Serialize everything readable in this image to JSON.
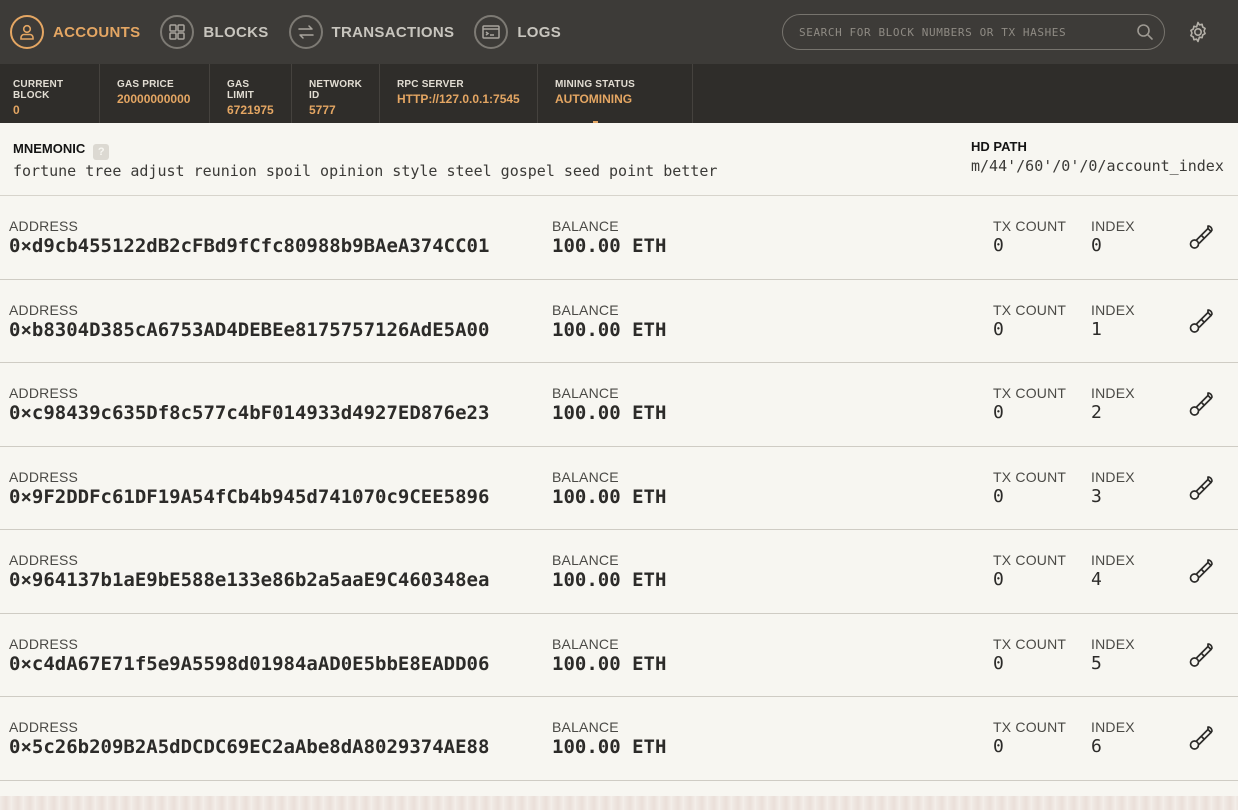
{
  "nav": {
    "items": [
      {
        "label": "ACCOUNTS",
        "icon": "person-icon",
        "active": true
      },
      {
        "label": "BLOCKS",
        "icon": "blocks-icon",
        "active": false
      },
      {
        "label": "TRANSACTIONS",
        "icon": "transfer-icon",
        "active": false
      },
      {
        "label": "LOGS",
        "icon": "terminal-icon",
        "active": false
      }
    ],
    "search_placeholder": "SEARCH FOR BLOCK NUMBERS OR TX HASHES"
  },
  "stats": {
    "current_block_label": "CURRENT BLOCK",
    "current_block": "0",
    "gas_price_label": "GAS PRICE",
    "gas_price": "20000000000",
    "gas_limit_label": "GAS LIMIT",
    "gas_limit": "6721975",
    "network_id_label": "NETWORK ID",
    "network_id": "5777",
    "rpc_server_label": "RPC SERVER",
    "rpc_server": "HTTP://127.0.0.1:7545",
    "mining_status_label": "MINING STATUS",
    "mining_status": "AUTOMINING"
  },
  "mnemonic": {
    "label": "MNEMONIC",
    "help": "?",
    "words": "fortune tree adjust reunion spoil opinion style steel gospel seed point better",
    "hd_path_label": "HD PATH",
    "hd_path": "m/44'/60'/0'/0/account_index"
  },
  "row_labels": {
    "address": "ADDRESS",
    "balance": "BALANCE",
    "tx_count": "TX COUNT",
    "index": "INDEX"
  },
  "accounts": [
    {
      "address": "0×d9cb455122dB2cFBd9fCfc80988b9BAeA374CC01",
      "balance": "100.00 ETH",
      "tx_count": "0",
      "index": "0"
    },
    {
      "address": "0×b8304D385cA6753AD4DEBEe8175757126AdE5A00",
      "balance": "100.00 ETH",
      "tx_count": "0",
      "index": "1"
    },
    {
      "address": "0×c98439c635Df8c577c4bF014933d4927ED876e23",
      "balance": "100.00 ETH",
      "tx_count": "0",
      "index": "2"
    },
    {
      "address": "0×9F2DDFc61DF19A54fCb4b945d741070c9CEE5896",
      "balance": "100.00 ETH",
      "tx_count": "0",
      "index": "3"
    },
    {
      "address": "0×964137b1aE9bE588e133e86b2a5aaE9C460348ea",
      "balance": "100.00 ETH",
      "tx_count": "0",
      "index": "4"
    },
    {
      "address": "0×c4dA67E71f5e9A5598d01984aAD0E5bbE8EADD06",
      "balance": "100.00 ETH",
      "tx_count": "0",
      "index": "5"
    },
    {
      "address": "0×5c26b209B2A5dDCDC69EC2aAbe8dA8029374AE88",
      "balance": "100.00 ETH",
      "tx_count": "0",
      "index": "6"
    }
  ],
  "colors": {
    "accent": "#e4a663",
    "nav_bg": "#3d3b38",
    "stats_bg": "#2f2d2a",
    "page_bg": "#f7f6f1"
  }
}
